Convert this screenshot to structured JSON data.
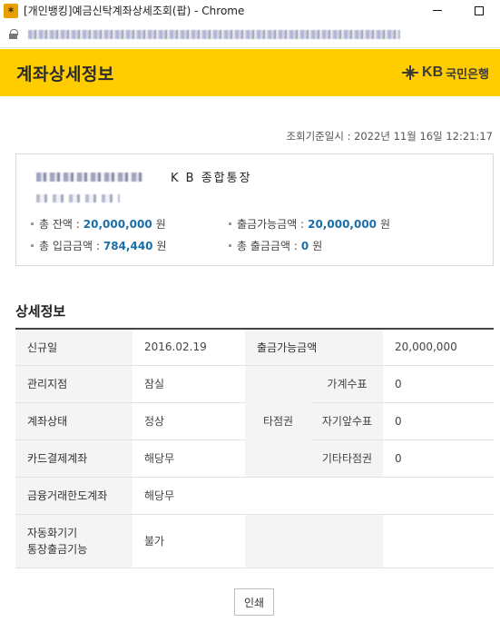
{
  "window": {
    "title": "[개인뱅킹]예금신탁계좌상세조회(팝) - Chrome"
  },
  "header": {
    "title": "계좌상세정보",
    "brand_kb": "KB",
    "brand_name": "국민은행"
  },
  "timestamp": "조회기준일시 : 2022년 11월 16일 12:21:17",
  "summary": {
    "account_type": "K B 종합통장",
    "total_balance_label": "총 잔액 :",
    "total_balance_value": "20,000,000",
    "withdrawable_label": "출금가능금액 :",
    "withdrawable_value": "20,000,000",
    "total_deposit_label": "총 입금금액 :",
    "total_deposit_value": "784,440",
    "total_withdrawal_label": "총 출금금액 :",
    "total_withdrawal_value": "0",
    "unit": "원"
  },
  "details": {
    "section_title": "상세정보",
    "open_date_label": "신규일",
    "open_date_value": "2016.02.19",
    "withdrawable_label": "출금가능금액",
    "withdrawable_value": "20,000,000",
    "branch_label": "관리지점",
    "branch_value": "잠실",
    "other_branch_label": "타점권",
    "household_check_label": "가계수표",
    "household_check_value": "0",
    "status_label": "계좌상태",
    "status_value": "정상",
    "own_check_label": "자기앞수표",
    "own_check_value": "0",
    "card_label": "카드결제계좌",
    "card_value": "해당무",
    "other_check_label": "기타타점권",
    "other_check_value": "0",
    "limit_label": "금융거래한도계좌",
    "limit_value": "해당무",
    "atm_label_1": "자동화기기",
    "atm_label_2": "통장출금기능",
    "atm_value": "불가"
  },
  "print_button": "인쇄"
}
